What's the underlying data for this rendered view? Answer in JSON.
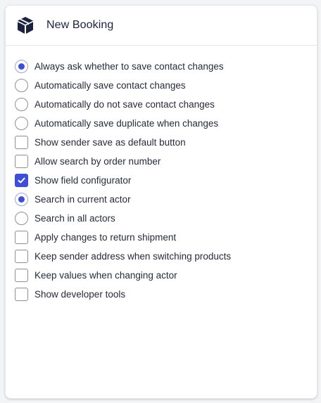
{
  "header": {
    "title": "New Booking",
    "icon": "box-icon"
  },
  "colors": {
    "accent": "#3d4fd6",
    "text": "#262b3c",
    "title": "#1b2240"
  },
  "options": [
    {
      "type": "radio",
      "checked": true,
      "label": "Always ask whether to save contact changes"
    },
    {
      "type": "radio",
      "checked": false,
      "label": "Automatically save contact changes"
    },
    {
      "type": "radio",
      "checked": false,
      "label": "Automatically do not save contact changes"
    },
    {
      "type": "radio",
      "checked": false,
      "label": "Automatically save duplicate when changes"
    },
    {
      "type": "checkbox",
      "checked": false,
      "label": "Show sender save as default button"
    },
    {
      "type": "checkbox",
      "checked": false,
      "label": "Allow search by order number"
    },
    {
      "type": "checkbox",
      "checked": true,
      "label": "Show field configurator"
    },
    {
      "type": "radio",
      "checked": true,
      "label": "Search in current actor"
    },
    {
      "type": "radio",
      "checked": false,
      "label": "Search in all actors"
    },
    {
      "type": "checkbox",
      "checked": false,
      "label": "Apply changes to return shipment"
    },
    {
      "type": "checkbox",
      "checked": false,
      "label": "Keep sender address when switching products"
    },
    {
      "type": "checkbox",
      "checked": false,
      "label": "Keep values when changing actor"
    },
    {
      "type": "checkbox",
      "checked": false,
      "label": "Show developer tools"
    }
  ]
}
